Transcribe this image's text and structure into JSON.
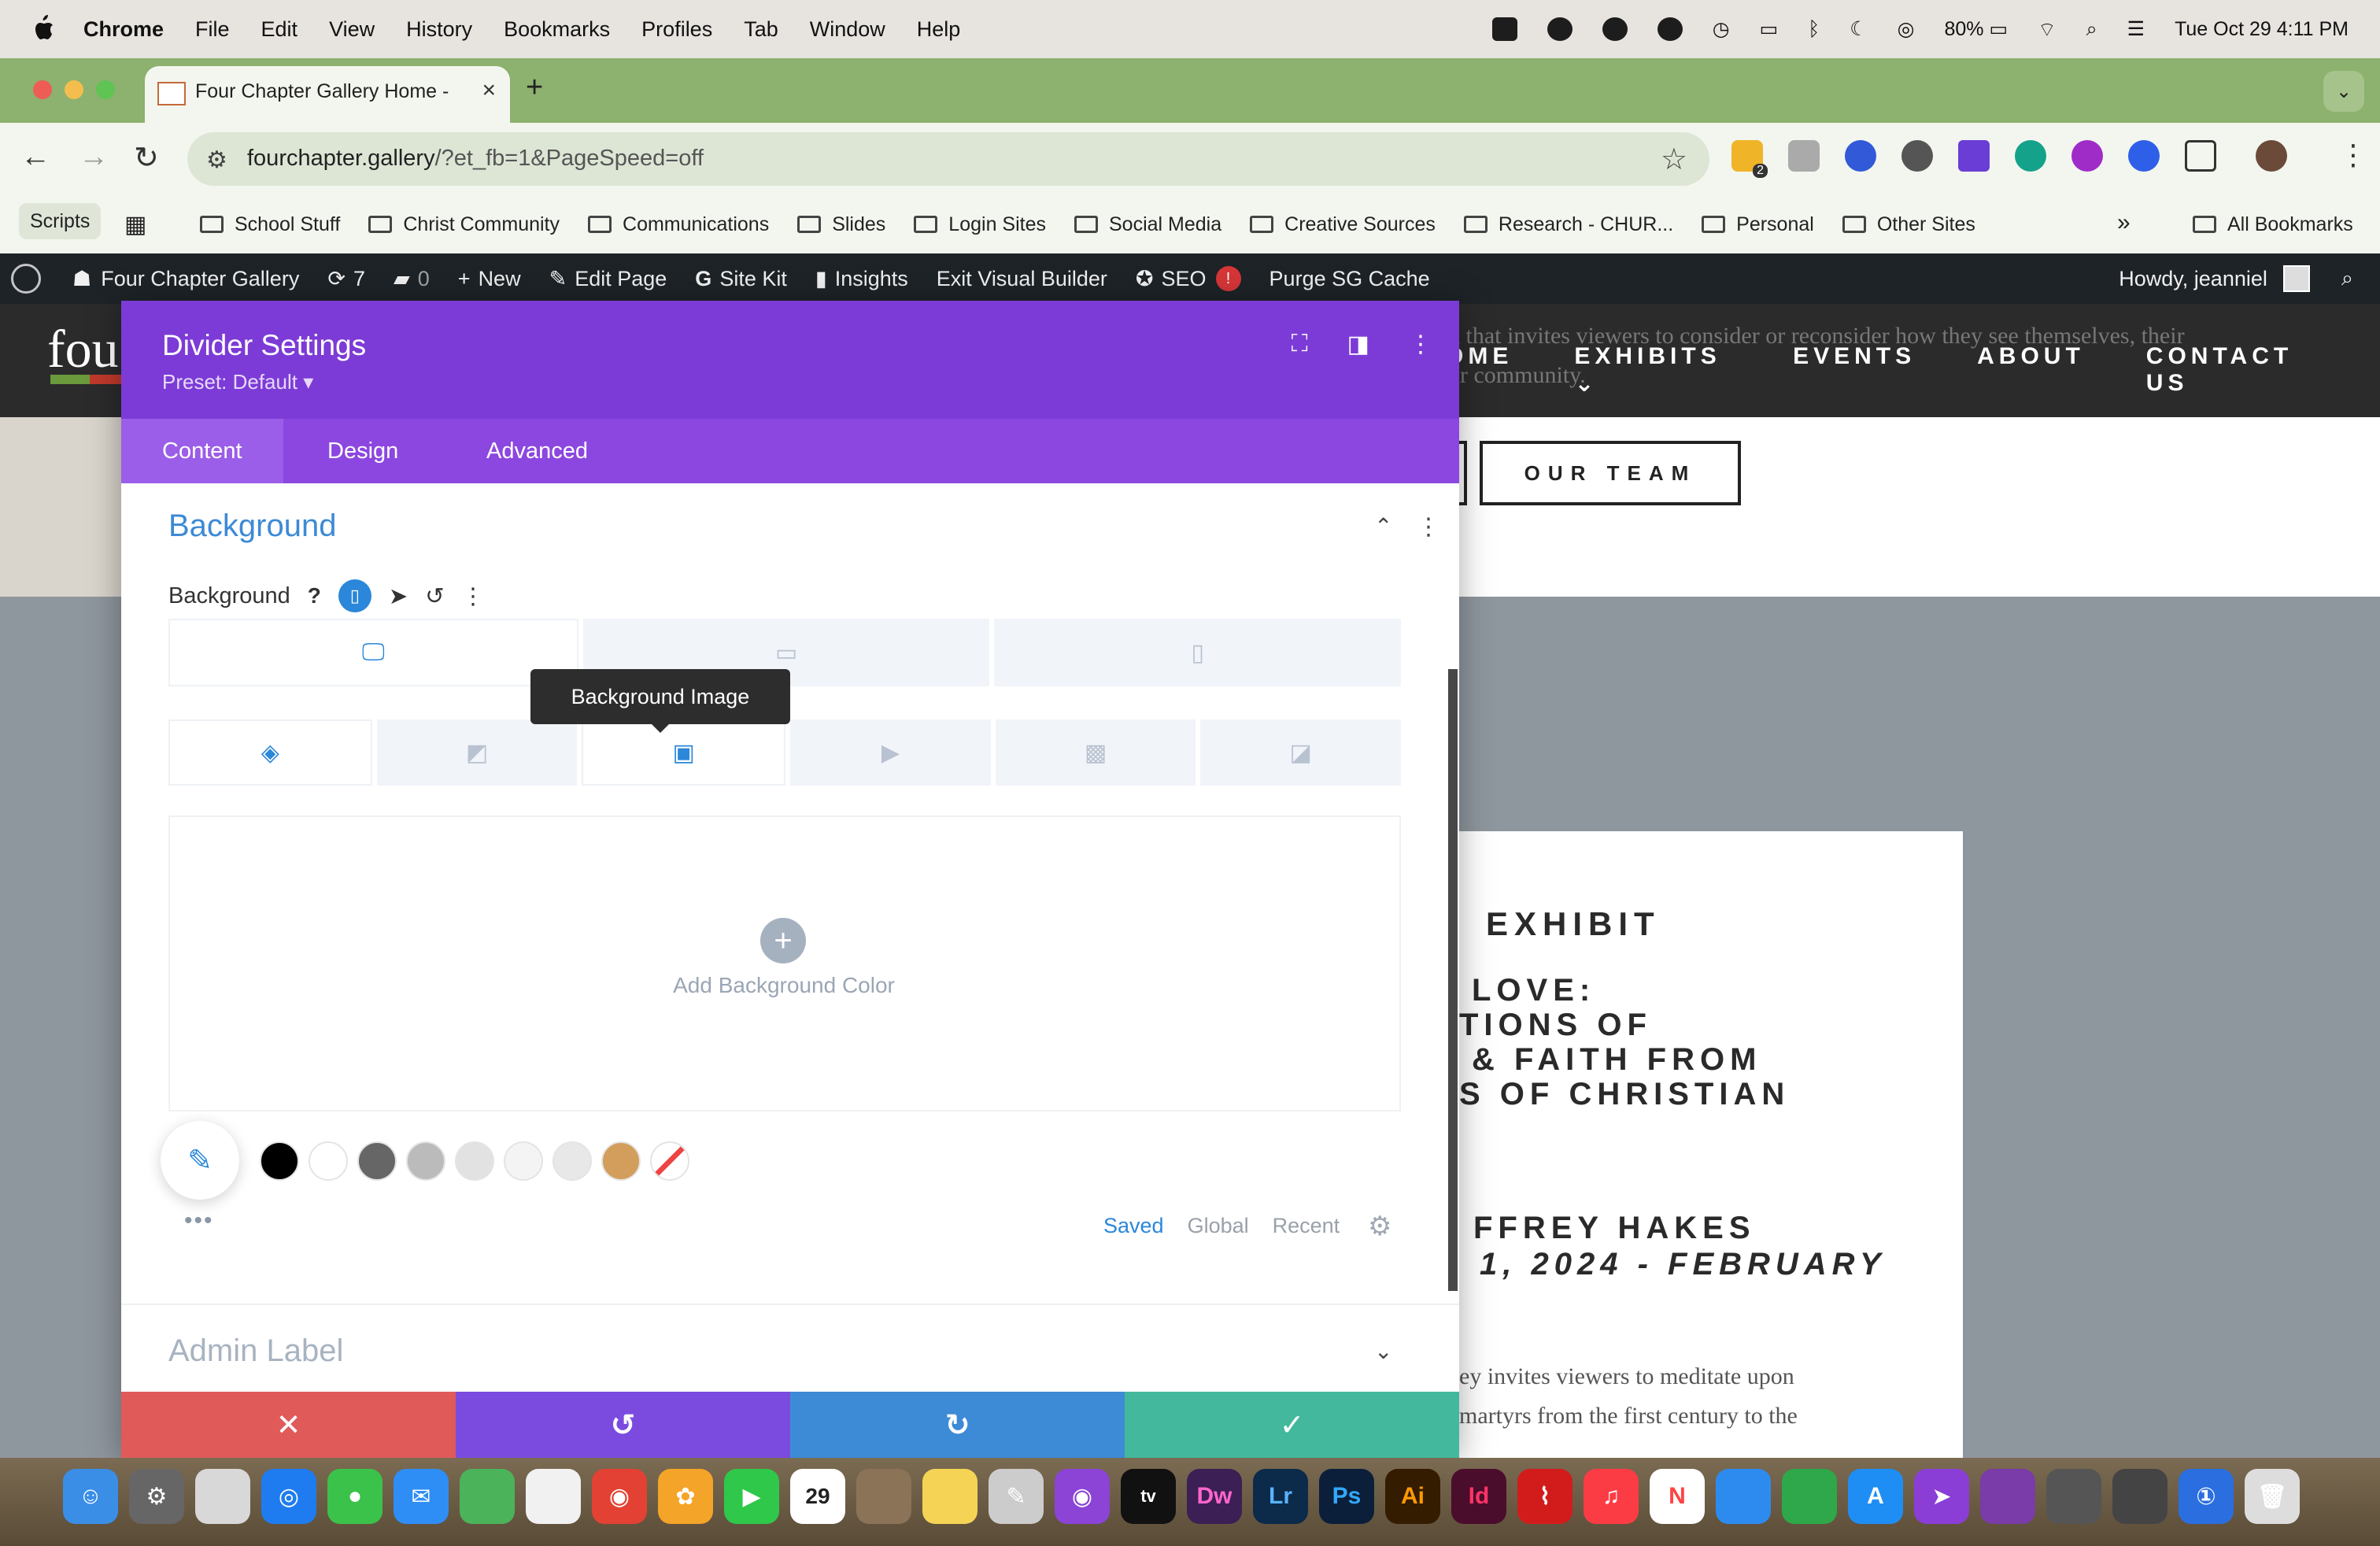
{
  "menubar": {
    "app": "Chrome",
    "menus": [
      "File",
      "Edit",
      "View",
      "History",
      "Bookmarks",
      "Profiles",
      "Tab",
      "Window",
      "Help"
    ],
    "battery": "80%",
    "datetime": "Tue Oct 29  4:11 PM"
  },
  "browser": {
    "tab_title": "Four Chapter Gallery Home -",
    "url_host": "fourchapter.gallery",
    "url_path": "/?et_fb=1&PageSpeed=off",
    "extension_badge": "2"
  },
  "bookmarks": {
    "scripts": "Scripts",
    "items": [
      "School Stuff",
      "Christ Community",
      "Communications",
      "Slides",
      "Login Sites",
      "Social Media",
      "Creative Sources",
      "Research - CHUR...",
      "Personal",
      "Other Sites"
    ],
    "more": "»",
    "all": "All Bookmarks"
  },
  "wpbar": {
    "site": "Four Chapter Gallery",
    "updates": "7",
    "comments": "0",
    "new": "New",
    "edit_page": "Edit Page",
    "site_kit": "Site Kit",
    "insights": "Insights",
    "exit_builder": "Exit Visual Builder",
    "seo": "SEO",
    "seo_badge": "!",
    "purge": "Purge SG Cache",
    "howdy": "Howdy, jeanniel"
  },
  "site": {
    "logo": "fou",
    "intro": "k that invites viewers to consider or reconsider how they see themselves, their\nur community.",
    "nav": [
      "OME",
      "EXHIBITS ⌄",
      "EVENTS",
      "ABOUT",
      "CONTACT US"
    ],
    "team_button": "OUR TEAM",
    "exhibit_heading": "EXHIBIT",
    "exhibit_lines": [
      "LOVE:",
      "TIONS OF",
      "& FAITH FROM",
      "S OF CHRISTIAN"
    ],
    "artist": "FFREY HAKES",
    "dates": "1, 2024 - FEBRUARY",
    "body_lines": [
      "ey invites viewers to meditate upon",
      "martyrs from the first century to the"
    ]
  },
  "modal": {
    "title": "Divider Settings",
    "preset": "Preset: Default ▾",
    "tabs": [
      "Content",
      "Design",
      "Advanced"
    ],
    "section_title": "Background",
    "field_label": "Background",
    "help": "?",
    "tooltip": "Background Image",
    "add_color": "Add Background Color",
    "palette_tabs": [
      "Saved",
      "Global",
      "Recent"
    ],
    "admin_label": "Admin Label",
    "swatches": [
      "#000000",
      "#ffffff",
      "#666666",
      "#bbbbbb",
      "#e2e2e2",
      "#f4f4f4",
      "#e8e8e8",
      "#d39d5b"
    ]
  },
  "colors": {
    "purple": "#7c3bd6",
    "accent_blue": "#2b87da",
    "cancel_red": "#e05a5a",
    "undo_purple": "#7b4be0",
    "redo_blue": "#3d8ad6",
    "save_green": "#43b89c"
  }
}
